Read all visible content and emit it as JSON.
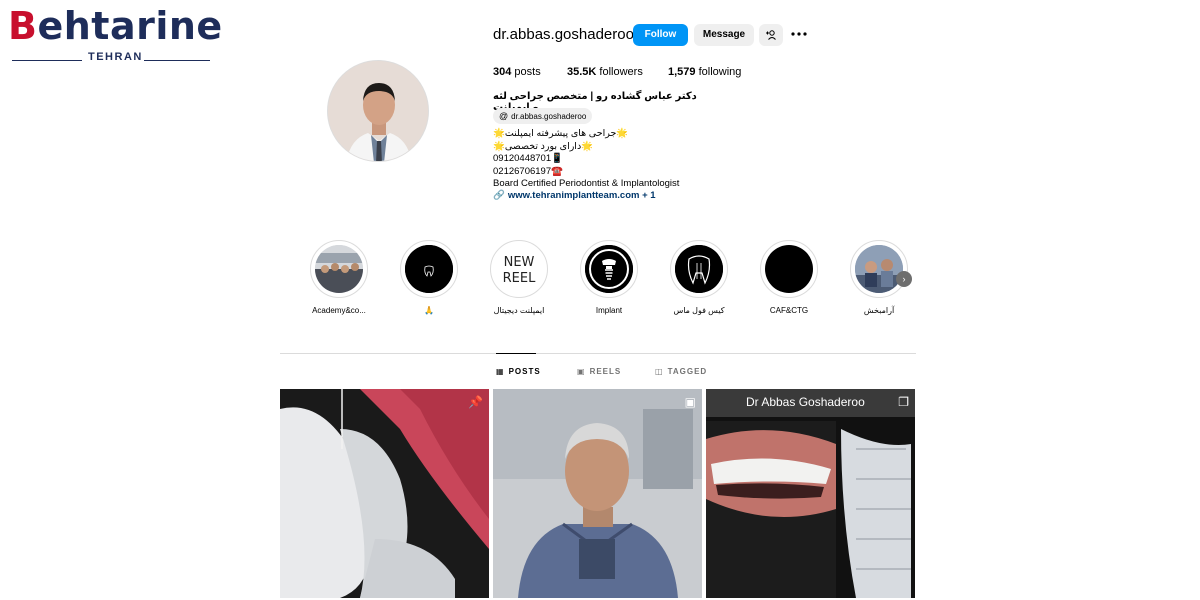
{
  "watermark": {
    "word": "ehtarine",
    "first_letter": "B",
    "sub": "TEHRAN"
  },
  "profile": {
    "username": "dr.abbas.goshaderoo",
    "follow_label": "Follow",
    "message_label": "Message",
    "stats": {
      "posts_count": "304",
      "posts_label": "posts",
      "followers_count": "35.5K",
      "followers_label": "followers",
      "following_count": "1,579",
      "following_label": "following"
    },
    "full_name": "دکتر عباس گشاده رو | متخصص جراحی لثه و ایمپلنت",
    "threads_handle": "dr.abbas.goshaderoo",
    "bio_lines": [
      "🌟جراحی های پیشرفته ایمپلنت🌟",
      "🌟دارای بورد تخصصی🌟",
      "09120448701📱",
      "02126706197☎️",
      "Board Certified Periodontist & Implantologist"
    ],
    "link_text": "www.tehranimplantteam.com + 1"
  },
  "highlights": [
    {
      "label": "Academy&co..."
    },
    {
      "label": "🙏"
    },
    {
      "label": "ایمپلنت دیجیتال"
    },
    {
      "label": "Implant"
    },
    {
      "label": "کیس فول ماس"
    },
    {
      "label": "CAF&CTG"
    },
    {
      "label": "آرامبخش"
    }
  ],
  "tabs": [
    {
      "label": "POSTS",
      "icon": "grid-icon"
    },
    {
      "label": "REELS",
      "icon": "reels-icon"
    },
    {
      "label": "TAGGED",
      "icon": "tagged-icon"
    }
  ],
  "posts": [
    {
      "badge_icon": "pin-icon"
    },
    {
      "badge_icon": "reel-icon"
    },
    {
      "badge_icon": "carousel-icon",
      "caption": "Dr Abbas Goshaderoo"
    }
  ],
  "colors": {
    "follow_blue": "#0095f6",
    "link_blue": "#00376b",
    "watermark_navy": "#1e2d5a",
    "watermark_red": "#c8102e"
  }
}
